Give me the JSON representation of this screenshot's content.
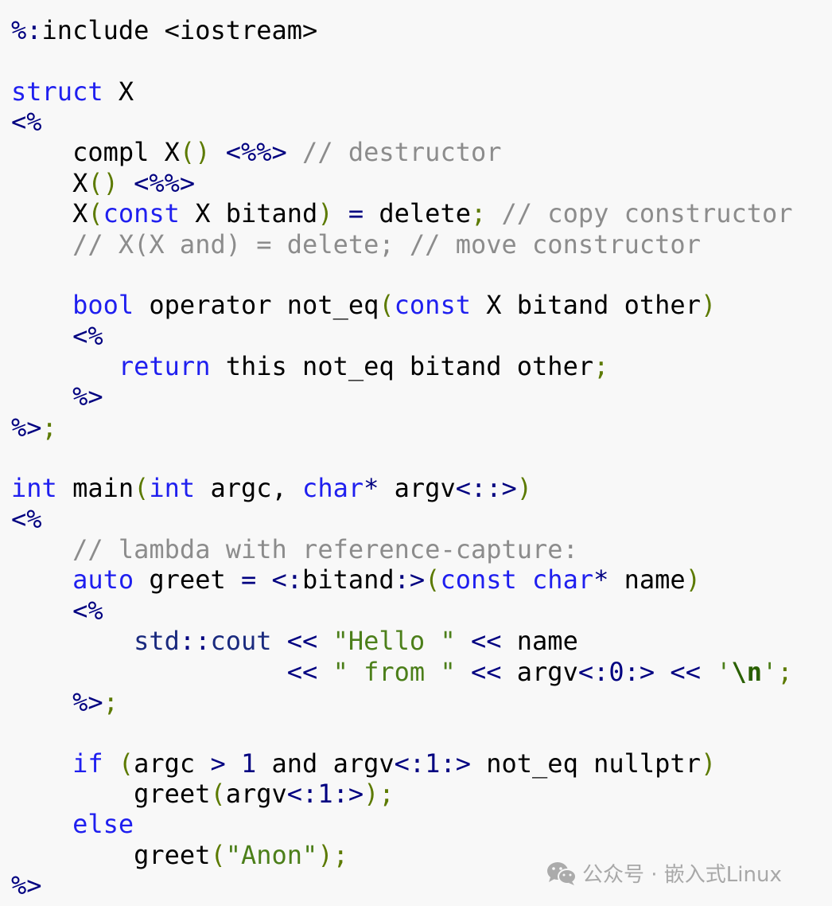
{
  "code": {
    "lines": [
      [
        {
          "k": "op",
          "v": "%:"
        },
        {
          "k": "t",
          "v": "include <iostream>"
        }
      ],
      [],
      [
        {
          "k": "kw",
          "v": "struct"
        },
        {
          "k": "t",
          "v": " X"
        }
      ],
      [
        {
          "k": "op",
          "v": "<%"
        }
      ],
      [
        {
          "k": "t",
          "v": "    compl X"
        },
        {
          "k": "p",
          "v": "()"
        },
        {
          "k": "t",
          "v": " "
        },
        {
          "k": "op",
          "v": "<%%>"
        },
        {
          "k": "t",
          "v": " "
        },
        {
          "k": "c",
          "v": "// destructor"
        }
      ],
      [
        {
          "k": "t",
          "v": "    X"
        },
        {
          "k": "p",
          "v": "()"
        },
        {
          "k": "t",
          "v": " "
        },
        {
          "k": "op",
          "v": "<%%>"
        }
      ],
      [
        {
          "k": "t",
          "v": "    X"
        },
        {
          "k": "p",
          "v": "("
        },
        {
          "k": "kw",
          "v": "const"
        },
        {
          "k": "t",
          "v": " X bitand"
        },
        {
          "k": "p",
          "v": ")"
        },
        {
          "k": "t",
          "v": " "
        },
        {
          "k": "op",
          "v": "="
        },
        {
          "k": "t",
          "v": " delete"
        },
        {
          "k": "p",
          "v": ";"
        },
        {
          "k": "t",
          "v": " "
        },
        {
          "k": "c",
          "v": "// copy constructor"
        }
      ],
      [
        {
          "k": "t",
          "v": "    "
        },
        {
          "k": "c",
          "v": "// X(X and) = delete; // move constructor"
        }
      ],
      [],
      [
        {
          "k": "t",
          "v": "    "
        },
        {
          "k": "kw",
          "v": "bool"
        },
        {
          "k": "t",
          "v": " operator not_eq"
        },
        {
          "k": "p",
          "v": "("
        },
        {
          "k": "kw",
          "v": "const"
        },
        {
          "k": "t",
          "v": " X bitand other"
        },
        {
          "k": "p",
          "v": ")"
        }
      ],
      [
        {
          "k": "t",
          "v": "    "
        },
        {
          "k": "op",
          "v": "<%"
        }
      ],
      [
        {
          "k": "t",
          "v": "       "
        },
        {
          "k": "kw",
          "v": "return"
        },
        {
          "k": "t",
          "v": " this not_eq bitand other"
        },
        {
          "k": "p",
          "v": ";"
        }
      ],
      [
        {
          "k": "t",
          "v": "    "
        },
        {
          "k": "op",
          "v": "%>"
        }
      ],
      [
        {
          "k": "op",
          "v": "%>"
        },
        {
          "k": "p",
          "v": ";"
        }
      ],
      [],
      [
        {
          "k": "kw",
          "v": "int"
        },
        {
          "k": "t",
          "v": " main"
        },
        {
          "k": "p",
          "v": "("
        },
        {
          "k": "kw",
          "v": "int"
        },
        {
          "k": "t",
          "v": " argc, "
        },
        {
          "k": "kw",
          "v": "char"
        },
        {
          "k": "op",
          "v": "*"
        },
        {
          "k": "t",
          "v": " argv"
        },
        {
          "k": "op",
          "v": "<::>"
        },
        {
          "k": "p",
          "v": ")"
        }
      ],
      [
        {
          "k": "op",
          "v": "<%"
        }
      ],
      [
        {
          "k": "t",
          "v": "    "
        },
        {
          "k": "c",
          "v": "// lambda with reference-capture:"
        }
      ],
      [
        {
          "k": "t",
          "v": "    "
        },
        {
          "k": "kw",
          "v": "auto"
        },
        {
          "k": "t",
          "v": " greet "
        },
        {
          "k": "op",
          "v": "="
        },
        {
          "k": "t",
          "v": " "
        },
        {
          "k": "op",
          "v": "<:"
        },
        {
          "k": "t",
          "v": "bitand"
        },
        {
          "k": "op",
          "v": ":>"
        },
        {
          "k": "p",
          "v": "("
        },
        {
          "k": "kw",
          "v": "const"
        },
        {
          "k": "t",
          "v": " "
        },
        {
          "k": "kw",
          "v": "char"
        },
        {
          "k": "op",
          "v": "*"
        },
        {
          "k": "t",
          "v": " name"
        },
        {
          "k": "p",
          "v": ")"
        }
      ],
      [
        {
          "k": "t",
          "v": "    "
        },
        {
          "k": "op",
          "v": "<%"
        }
      ],
      [
        {
          "k": "t",
          "v": "        "
        },
        {
          "k": "ns",
          "v": "std"
        },
        {
          "k": "op",
          "v": "::"
        },
        {
          "k": "ns",
          "v": "cout"
        },
        {
          "k": "t",
          "v": " "
        },
        {
          "k": "op",
          "v": "<<"
        },
        {
          "k": "t",
          "v": " "
        },
        {
          "k": "s",
          "v": "\"Hello \""
        },
        {
          "k": "t",
          "v": " "
        },
        {
          "k": "op",
          "v": "<<"
        },
        {
          "k": "t",
          "v": " name"
        }
      ],
      [
        {
          "k": "t",
          "v": "                  "
        },
        {
          "k": "op",
          "v": "<<"
        },
        {
          "k": "t",
          "v": " "
        },
        {
          "k": "s",
          "v": "\" from \""
        },
        {
          "k": "t",
          "v": " "
        },
        {
          "k": "op",
          "v": "<<"
        },
        {
          "k": "t",
          "v": " argv"
        },
        {
          "k": "op",
          "v": "<:"
        },
        {
          "k": "n",
          "v": "0"
        },
        {
          "k": "op",
          "v": ":>"
        },
        {
          "k": "t",
          "v": " "
        },
        {
          "k": "op",
          "v": "<<"
        },
        {
          "k": "t",
          "v": " "
        },
        {
          "k": "s",
          "v": "'"
        },
        {
          "k": "e",
          "v": "\\n"
        },
        {
          "k": "s",
          "v": "'"
        },
        {
          "k": "p",
          "v": ";"
        }
      ],
      [
        {
          "k": "t",
          "v": "    "
        },
        {
          "k": "op",
          "v": "%>"
        },
        {
          "k": "p",
          "v": ";"
        }
      ],
      [],
      [
        {
          "k": "t",
          "v": "    "
        },
        {
          "k": "kw",
          "v": "if"
        },
        {
          "k": "t",
          "v": " "
        },
        {
          "k": "p",
          "v": "("
        },
        {
          "k": "t",
          "v": "argc "
        },
        {
          "k": "op",
          "v": ">"
        },
        {
          "k": "t",
          "v": " "
        },
        {
          "k": "n",
          "v": "1"
        },
        {
          "k": "t",
          "v": " and argv"
        },
        {
          "k": "op",
          "v": "<:"
        },
        {
          "k": "n",
          "v": "1"
        },
        {
          "k": "op",
          "v": ":>"
        },
        {
          "k": "t",
          "v": " not_eq nullptr"
        },
        {
          "k": "p",
          "v": ")"
        }
      ],
      [
        {
          "k": "t",
          "v": "        greet"
        },
        {
          "k": "p",
          "v": "("
        },
        {
          "k": "t",
          "v": "argv"
        },
        {
          "k": "op",
          "v": "<:"
        },
        {
          "k": "n",
          "v": "1"
        },
        {
          "k": "op",
          "v": ":>"
        },
        {
          "k": "p",
          "v": ");"
        }
      ],
      [
        {
          "k": "t",
          "v": "    "
        },
        {
          "k": "kw",
          "v": "else"
        }
      ],
      [
        {
          "k": "t",
          "v": "        greet"
        },
        {
          "k": "p",
          "v": "("
        },
        {
          "k": "s",
          "v": "\"Anon\""
        },
        {
          "k": "p",
          "v": ");"
        }
      ],
      [
        {
          "k": "op",
          "v": "%>"
        }
      ]
    ]
  },
  "colors": {
    "keyword": "#1f1fef",
    "operator": "#000080",
    "punctuation": "#5c7a00",
    "comment": "#8c8c8c",
    "string": "#4c7f1a",
    "background": "#f8f8f8"
  },
  "watermark": {
    "icon": "wechat-icon",
    "text": "公众号 · 嵌入式Linux"
  }
}
